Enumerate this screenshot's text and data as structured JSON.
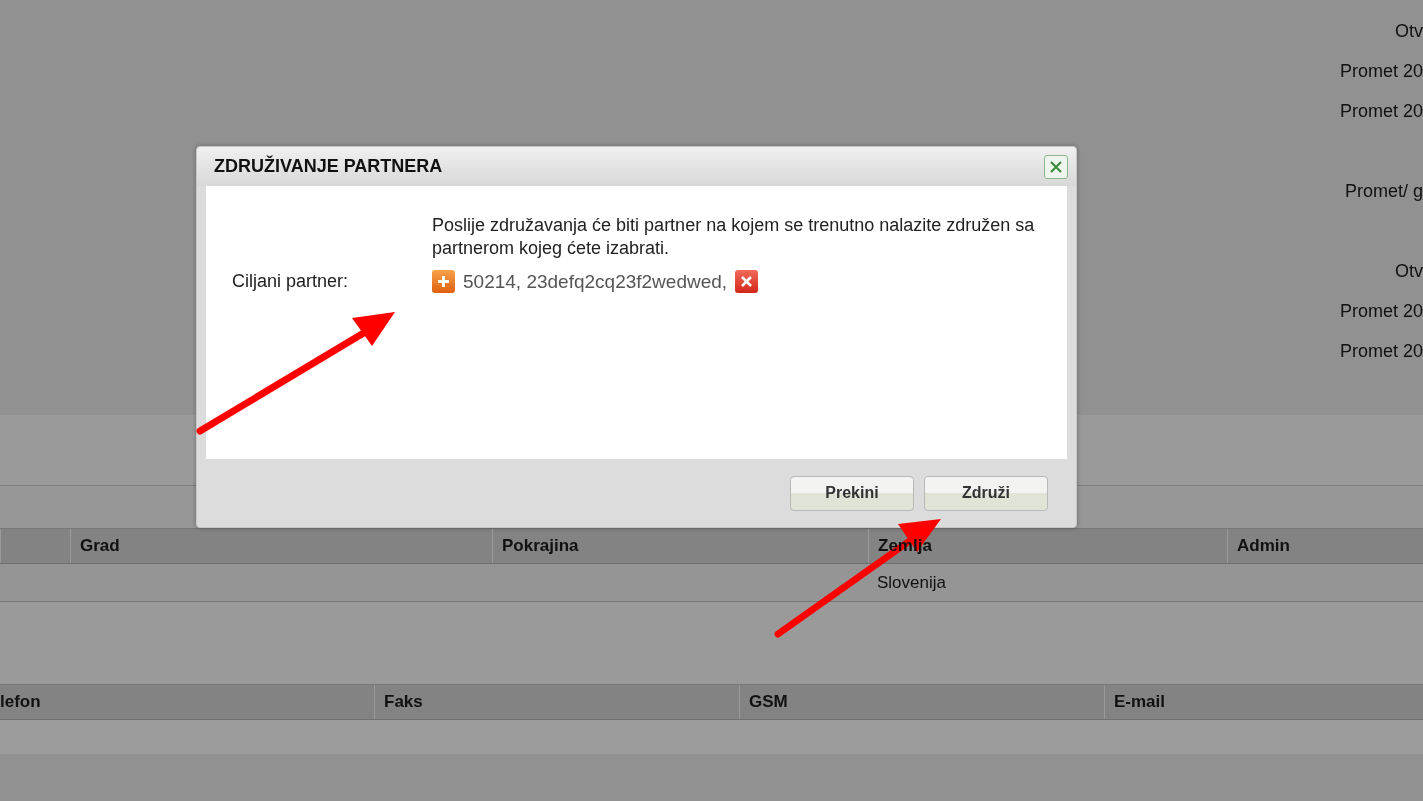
{
  "side_labels": [
    "Otv",
    "Promet 20",
    "Promet 20",
    "Promet/ g",
    "Otv",
    "Promet 20",
    "Promet 20"
  ],
  "location_table": {
    "columns": [
      "",
      "Grad",
      "Pokrajina",
      "Zemlja",
      "Admin"
    ],
    "rows": [
      [
        "",
        "",
        "",
        "Slovenija",
        ""
      ]
    ]
  },
  "contact_table": {
    "columns": [
      "lefon",
      "Faks",
      "GSM",
      "E-mail"
    ]
  },
  "dialog": {
    "title": "ZDRUŽIVANJE PARTNERA",
    "message": "Poslije združavanja će biti partner na kojem se trenutno nalazite združen sa partnerom kojeg ćete izabrati.",
    "field_label": "Ciljani partner:",
    "partner": "50214, 23defq2cq23f2wedwed,",
    "buttons": [
      "Prekini",
      "Združi"
    ]
  }
}
